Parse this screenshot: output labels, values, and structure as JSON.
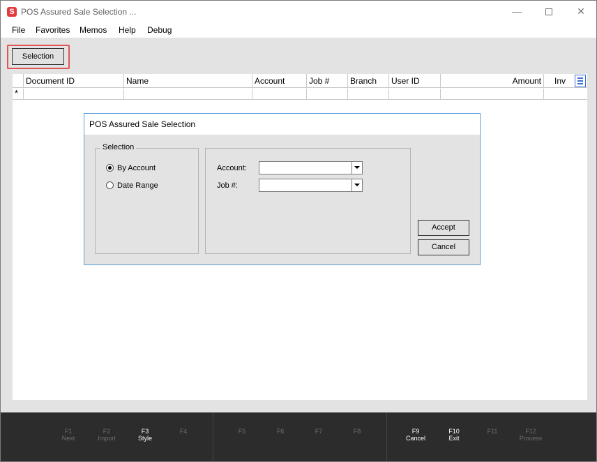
{
  "window": {
    "title": "POS Assured Sale Selection ...",
    "app_icon_letter": "S",
    "minimize_glyph": "—",
    "close_glyph": "✕"
  },
  "menu": [
    "File",
    "Favorites",
    "Memos",
    "Help",
    "Debug"
  ],
  "toolbar": {
    "selection_label": "Selection"
  },
  "grid": {
    "columns": [
      "Document ID",
      "Name",
      "Account",
      "Job #",
      "Branch",
      "User ID",
      "Amount",
      "Inv"
    ],
    "new_row_marker": "*"
  },
  "dialog": {
    "title": "POS Assured Sale Selection",
    "selection_group": {
      "legend": "Selection",
      "options": [
        {
          "label": "By Account",
          "checked": true
        },
        {
          "label": "Date Range",
          "checked": false
        }
      ]
    },
    "fields": {
      "account_label": "Account:",
      "account_value": "",
      "job_label": "Job #:",
      "job_value": ""
    },
    "accept_label": "Accept",
    "cancel_label": "Cancel"
  },
  "footer": {
    "keys": [
      {
        "key": "F1",
        "label": "Next",
        "active": false
      },
      {
        "key": "F2",
        "label": "Import",
        "active": false
      },
      {
        "key": "F3",
        "label": "Style",
        "active": true
      },
      {
        "key": "F4",
        "label": "",
        "active": false
      },
      {
        "key": "F5",
        "label": "",
        "active": false
      },
      {
        "key": "F6",
        "label": "",
        "active": false
      },
      {
        "key": "F7",
        "label": "",
        "active": false
      },
      {
        "key": "F8",
        "label": "",
        "active": false
      },
      {
        "key": "F9",
        "label": "Cancel",
        "active": true
      },
      {
        "key": "F10",
        "label": "Exit",
        "active": true
      },
      {
        "key": "F11",
        "label": "",
        "active": false
      },
      {
        "key": "F12",
        "label": "Process",
        "active": false
      }
    ]
  }
}
